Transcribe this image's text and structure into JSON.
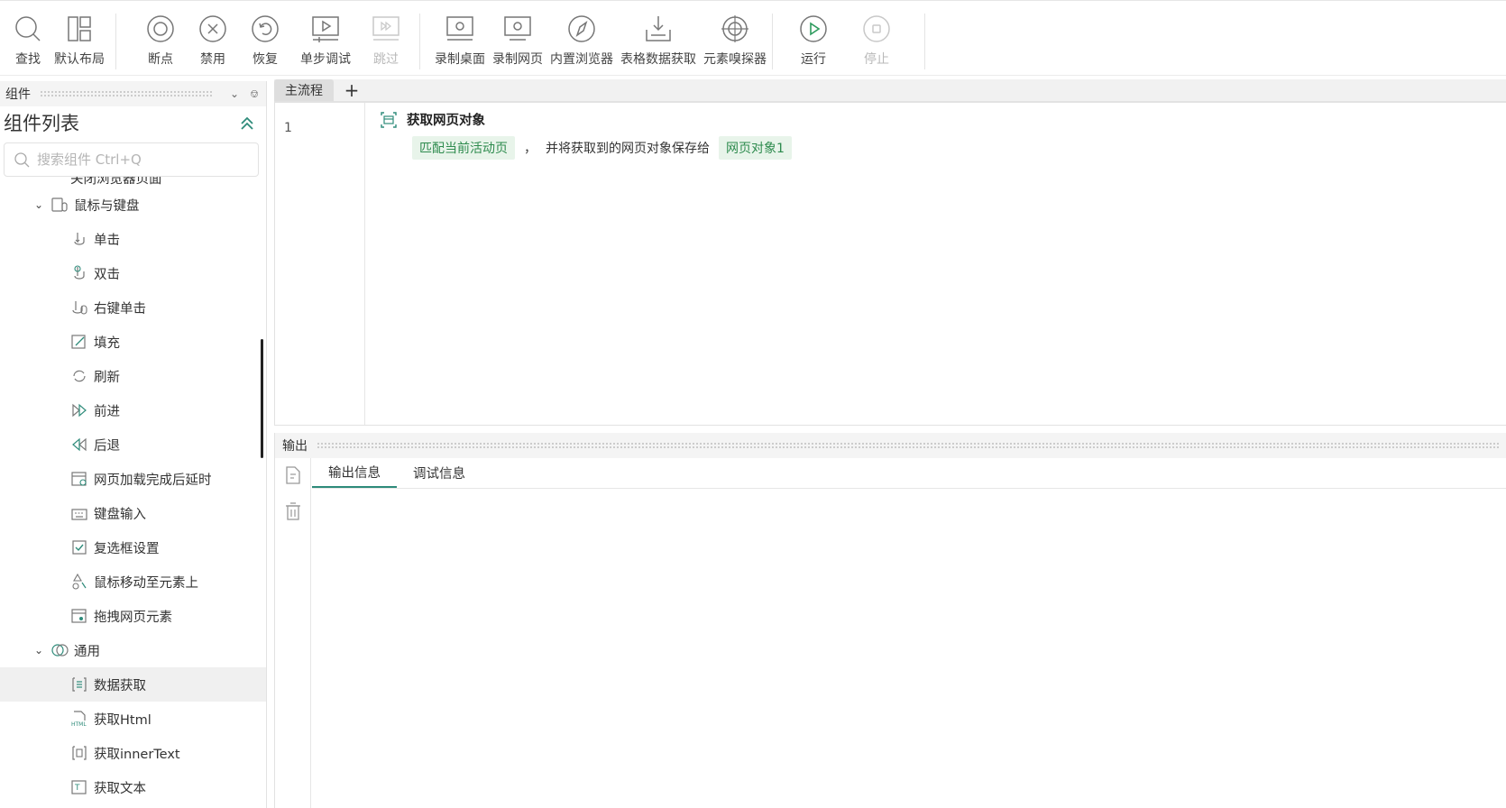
{
  "toolbar": {
    "groups": [
      [
        {
          "label": "查找",
          "icon": "search-icon"
        },
        {
          "label": "默认布局",
          "icon": "layout-icon"
        }
      ],
      [
        {
          "label": "断点",
          "icon": "breakpoint-icon"
        },
        {
          "label": "禁用",
          "icon": "disable-icon"
        },
        {
          "label": "恢复",
          "icon": "restore-icon"
        },
        {
          "label": "单步调试",
          "icon": "step-debug-icon"
        },
        {
          "label": "跳过",
          "icon": "skip-icon",
          "disabled": true
        }
      ],
      [
        {
          "label": "录制桌面",
          "icon": "record-desktop-icon"
        },
        {
          "label": "录制网页",
          "icon": "record-web-icon"
        },
        {
          "label": "内置浏览器",
          "icon": "browser-icon"
        },
        {
          "label": "表格数据获取",
          "icon": "table-data-icon"
        },
        {
          "label": "元素嗅探器",
          "icon": "element-sniffer-icon"
        }
      ],
      [
        {
          "label": "运行",
          "icon": "run-icon"
        },
        {
          "label": "停止",
          "icon": "stop-icon",
          "disabled": true
        }
      ]
    ]
  },
  "left_panel": {
    "header": "组件",
    "title": "组件列表",
    "search_placeholder": "搜索组件 Ctrl+Q",
    "tree": [
      {
        "type": "partial",
        "label": "关闭浏览器页面"
      },
      {
        "type": "cat",
        "label": "鼠标与键盘",
        "icon": "mouse-keyboard-icon"
      },
      {
        "type": "item",
        "label": "单击",
        "icon": "click-icon"
      },
      {
        "type": "item",
        "label": "双击",
        "icon": "double-click-icon"
      },
      {
        "type": "item",
        "label": "右键单击",
        "icon": "right-click-icon"
      },
      {
        "type": "item",
        "label": "填充",
        "icon": "fill-icon"
      },
      {
        "type": "item",
        "label": "刷新",
        "icon": "refresh-icon"
      },
      {
        "type": "item",
        "label": "前进",
        "icon": "forward-icon"
      },
      {
        "type": "item",
        "label": "后退",
        "icon": "back-icon"
      },
      {
        "type": "item",
        "label": "网页加载完成后延时",
        "icon": "page-delay-icon"
      },
      {
        "type": "item",
        "label": "键盘输入",
        "icon": "keyboard-icon"
      },
      {
        "type": "item",
        "label": "复选框设置",
        "icon": "checkbox-icon"
      },
      {
        "type": "item",
        "label": "鼠标移动至元素上",
        "icon": "hover-icon"
      },
      {
        "type": "item",
        "label": "拖拽网页元素",
        "icon": "drag-icon"
      },
      {
        "type": "cat",
        "label": "通用",
        "icon": "general-icon"
      },
      {
        "type": "item",
        "label": "数据获取",
        "icon": "data-get-icon",
        "selected": true
      },
      {
        "type": "item",
        "label": "获取Html",
        "icon": "html-icon"
      },
      {
        "type": "item",
        "label": "获取innerText",
        "icon": "inner-text-icon"
      },
      {
        "type": "item",
        "label": "获取文本",
        "icon": "get-text-icon"
      }
    ]
  },
  "flow": {
    "tab": "主流程",
    "add": "+",
    "line_number": "1",
    "step": {
      "title": "获取网页对象",
      "chip1": "匹配当前活动页",
      "sep": "，",
      "middle": "并将获取到的网页对象保存给",
      "chip2": "网页对象1"
    }
  },
  "output": {
    "header": "输出",
    "tabs": [
      "输出信息",
      "调试信息"
    ]
  }
}
